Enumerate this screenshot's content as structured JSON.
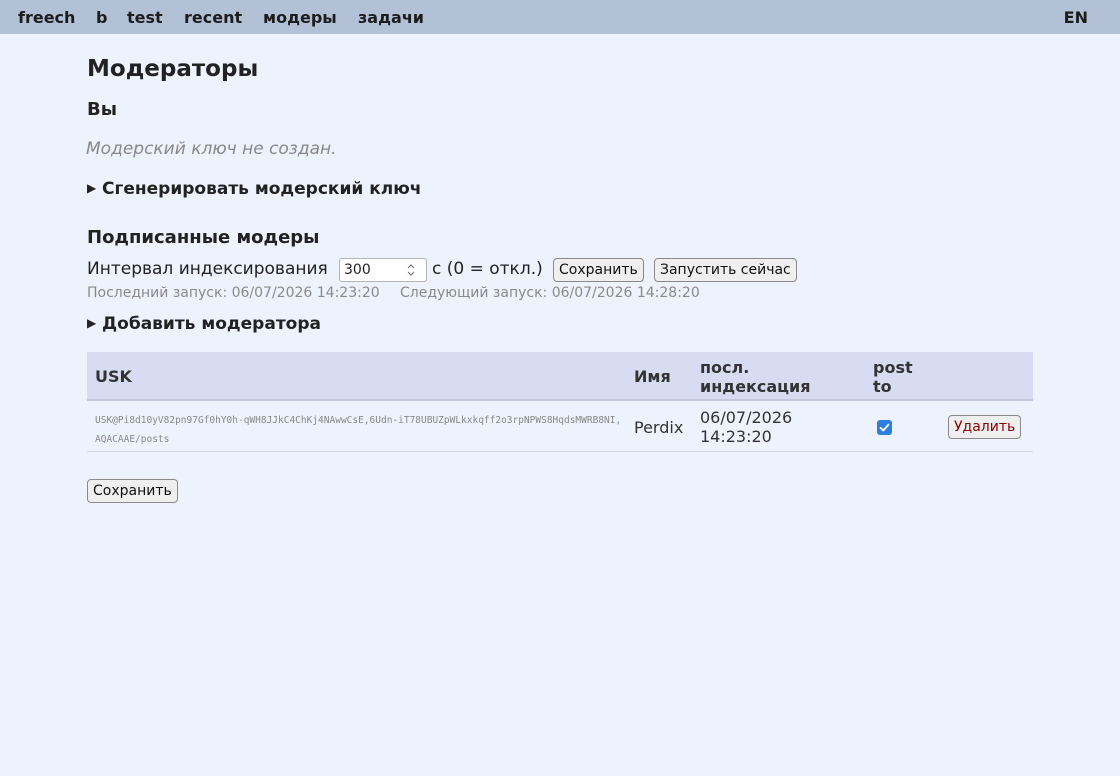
{
  "nav": {
    "items": [
      "freech",
      "b",
      "test",
      "recent",
      "модеры",
      "задачи"
    ],
    "lang": "EN"
  },
  "page": {
    "title": "Модераторы",
    "you_heading": "Вы",
    "no_key_note": "Модерский ключ не создан.",
    "generate_key_summary": "Сгенерировать модерский ключ",
    "subscribed_heading": "Подписанные модеры",
    "interval_label": "Интервал индексирования",
    "interval_value": "300",
    "interval_unit": "с (0 = откл.)",
    "save_interval_button": "Сохранить",
    "run_now_button": "Запустить сейчас",
    "last_run": "Последний запуск: 06/07/2026 14:23:20",
    "next_run": "Следующий запуск: 06/07/2026 14:28:20",
    "add_moderator_summary": "Добавить модератора",
    "save_button": "Сохранить"
  },
  "table": {
    "headers": {
      "usk": "USK",
      "name": "Имя",
      "last_index_1": "посл.",
      "last_index_2": "индексация",
      "post_to_1": "post",
      "post_to_2": "to"
    },
    "rows": [
      {
        "usk": "USK@Pi8d10yV82pn97Gf0hY0h-qWH8JJkC4ChKj4NAwwCsE,6Udn-iT78UBUZpWLkxkqff2o3rpNPWS8HqdsMWRB8NI,AQACAAE/posts",
        "name": "Perdix",
        "date": "06/07/2026",
        "time": "14:23:20",
        "post_to": true,
        "delete_label": "Удалить"
      }
    ]
  },
  "colors": {
    "topbar": "#b3c1d7",
    "background": "#eef2fc",
    "table_header": "#d7dcf2",
    "checkbox": "#2e7ee0",
    "delete_text": "#8b0000"
  }
}
